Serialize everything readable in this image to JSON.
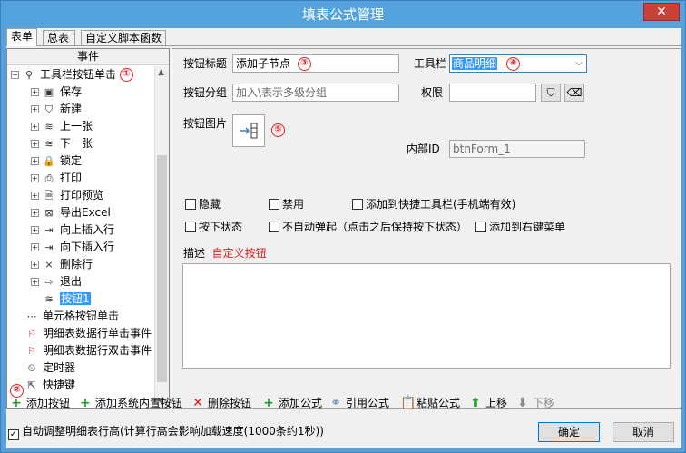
{
  "window": {
    "title": "填表公式管理",
    "close_glyph": "✕"
  },
  "tabs": [
    "表单",
    "总表",
    "自定义脚本函数"
  ],
  "left_panel": {
    "header": "事件",
    "root": {
      "label": "工具栏按钮单击",
      "badge": "①"
    },
    "children": [
      {
        "label": "保存",
        "icon": "save-icon",
        "glyph": "▣"
      },
      {
        "label": "新建",
        "icon": "shield-plus-icon",
        "glyph": "⛉"
      },
      {
        "label": "上一张",
        "icon": "layers-up-icon",
        "glyph": "≋"
      },
      {
        "label": "下一张",
        "icon": "layers-down-icon",
        "glyph": "≋"
      },
      {
        "label": "锁定",
        "icon": "lock-icon",
        "glyph": "🔒"
      },
      {
        "label": "打印",
        "icon": "print-icon",
        "glyph": "⎙"
      },
      {
        "label": "打印预览",
        "icon": "print-preview-icon",
        "glyph": "🗎"
      },
      {
        "label": "导出Excel",
        "icon": "excel-icon",
        "glyph": "⊠"
      },
      {
        "label": "向上插入行",
        "icon": "insert-above-icon",
        "glyph": "⇥"
      },
      {
        "label": "向下插入行",
        "icon": "insert-below-icon",
        "glyph": "⇥"
      },
      {
        "label": "删除行",
        "icon": "delete-row-icon",
        "glyph": "⨯"
      },
      {
        "label": "退出",
        "icon": "exit-icon",
        "glyph": "⇨"
      },
      {
        "label": "按钮1",
        "icon": "layers-icon",
        "glyph": "≋"
      }
    ],
    "siblings": [
      {
        "label": "单元格按钮单击",
        "icon": "dots-icon",
        "glyph": "⋯"
      },
      {
        "label": "明细表数据行单击事件",
        "icon": "flag-icon",
        "glyph": "⚐"
      },
      {
        "label": "明细表数据行双击事件",
        "icon": "flag-icon",
        "glyph": "⚐"
      },
      {
        "label": "定时器",
        "icon": "timer-icon",
        "glyph": "⏲"
      },
      {
        "label": "快捷键",
        "icon": "shortcut-icon",
        "glyph": "⇱"
      }
    ]
  },
  "form": {
    "button_title_label": "按钮标题",
    "button_title_value": "添加子节点",
    "badge3": "③",
    "toolbar_label": "工具栏",
    "toolbar_value": "商品明细",
    "badge4": "④",
    "group_label": "按钮分组",
    "group_placeholder": "加入\\表示多级分组",
    "permission_label": "权限",
    "image_label": "按钮图片",
    "badge5": "⑤",
    "internal_id_label": "内部ID",
    "internal_id_value": "btnForm_1",
    "checkboxes": [
      "隐藏",
      "禁用",
      "添加到快捷工具栏(手机端有效)",
      "按下状态",
      "不自动弹起（点击之后保持按下状态）",
      "添加到右键菜单"
    ],
    "desc_label": "描述",
    "desc_value": "自定义按钮"
  },
  "toolbar": {
    "badge2": "②",
    "add_button": "添加按钮",
    "add_system_button": "添加系统内置按钮",
    "delete_button": "删除按钮",
    "add_formula": "添加公式",
    "reference_formula": "引用公式",
    "paste_formula": "粘贴公式",
    "move_up": "上移",
    "move_down": "下移"
  },
  "footer": {
    "auto_adjust_label": "自动调整明细表行高(计算行高会影响加载速度(1000条约1秒))",
    "ok": "确定",
    "cancel": "取消"
  },
  "colors": {
    "accent": "#3399ff",
    "badge_red": "#e02020",
    "add_green": "#1e9e2f"
  }
}
